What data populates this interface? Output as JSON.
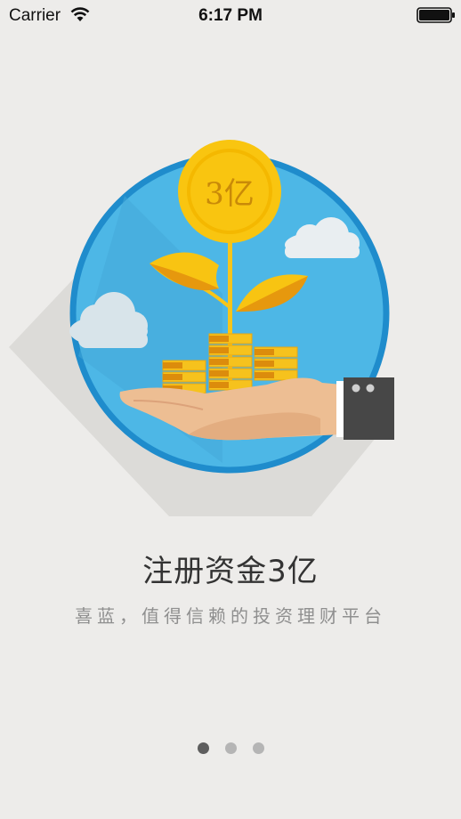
{
  "status_bar": {
    "carrier": "Carrier",
    "time": "6:17 PM"
  },
  "illustration": {
    "coin_label": "3亿",
    "icons": [
      "coin-tree",
      "money-stack",
      "hand",
      "cloud"
    ]
  },
  "content": {
    "title": "注册资金3亿",
    "subtitle": "喜蓝，值得信赖的投资理财平台"
  },
  "pager": {
    "total": 3,
    "active_index": 0
  },
  "colors": {
    "background": "#edecea",
    "circle_blue": "#4db7e6",
    "circle_border": "#1f8ccc",
    "gold": "#f9c510",
    "dot_active": "#5e5e5e",
    "dot_inactive": "#b5b5b5"
  }
}
